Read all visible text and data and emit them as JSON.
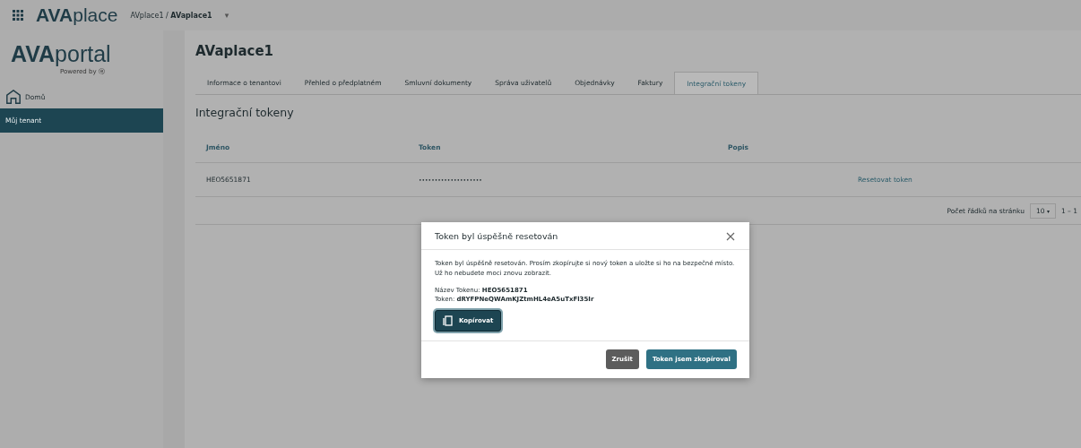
{
  "topbar": {
    "logo_bold": "AVA",
    "logo_light": "place",
    "breadcrumb": "AVplace1 / **AVaplace1**",
    "caret": "▾"
  },
  "sidebar": {
    "logo_bold": "AVA",
    "logo_light": "portal",
    "powered": "Powered by ⓔ",
    "items": [
      {
        "label": "Domů",
        "kind": "home",
        "selected": false
      },
      {
        "label": "Můj tenant",
        "kind": "plain",
        "selected": true
      }
    ]
  },
  "page": {
    "title": "AVaplace1",
    "tabs": [
      {
        "label": "Informace o tenantovi",
        "selected": false
      },
      {
        "label": "Přehled o předplatném",
        "selected": false
      },
      {
        "label": "Smluvní dokumenty",
        "selected": false
      },
      {
        "label": "Správa uživatelů",
        "selected": false
      },
      {
        "label": "Objednávky",
        "selected": false
      },
      {
        "label": "Faktury",
        "selected": false
      },
      {
        "label": "Integrační tokeny",
        "selected": true
      }
    ],
    "section_title": "Integrační tokeny",
    "table": {
      "columns": [
        "Jméno",
        "Token",
        "Popis"
      ],
      "rows": [
        {
          "name": "HEO5651871",
          "token": "••••••••••••••••••••",
          "action": "Resetovat token"
        }
      ]
    },
    "pagination": {
      "label": "Počet řádků na stránku",
      "page_size": "10",
      "range": "1 – 1"
    }
  },
  "dialog": {
    "title": "Token byl úspěšně resetován",
    "message": "Token byl úspěšně resetován. Prosím zkopírujte si nový token a uložte si ho na bezpečné místo. Už ho nebudete moci znovu zobrazit.",
    "name_line": "Název Tokenu: **HEO5651871**",
    "token_line": "Token: **dRYFPNeQWAmKJZtmHL4eA5uTxFl35Ir**",
    "copy_button": "Kopírovat",
    "buttons": [
      {
        "label": "Zrušit",
        "kind": "secondary"
      },
      {
        "label": "Token jsem zkopíroval",
        "kind": "primary"
      }
    ]
  }
}
